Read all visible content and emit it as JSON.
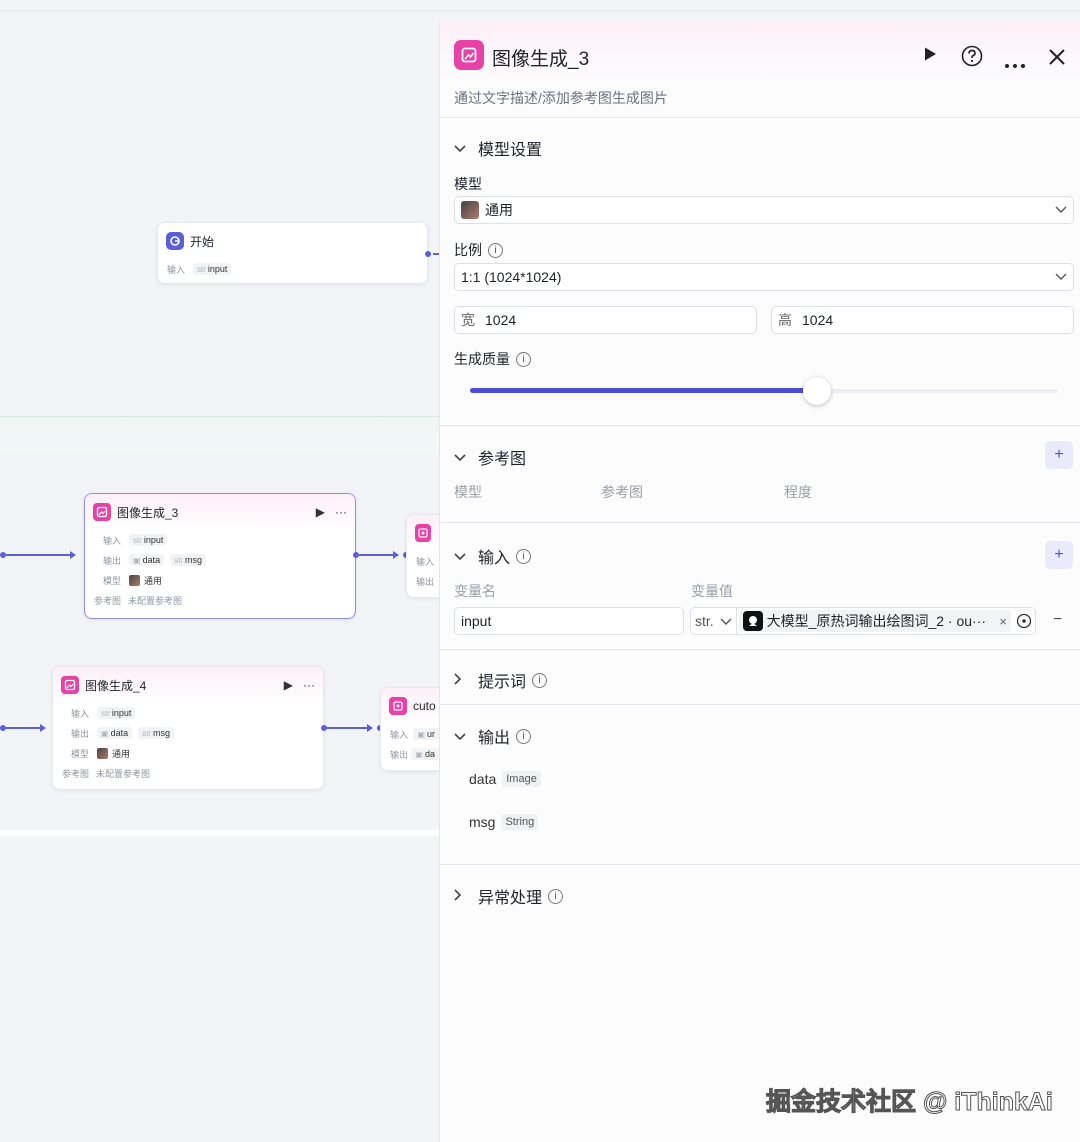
{
  "canvas": {
    "start_node": {
      "title": "开始",
      "in_label": "输入",
      "in_type": "str",
      "in_var": "input"
    },
    "node3": {
      "title": "图像生成_3",
      "run": "▶",
      "more": "···",
      "in_label": "输入",
      "out_label": "输出",
      "model_label": "模型",
      "ref_label": "参考图",
      "in_type": "str",
      "in_var": "input",
      "out1": "data",
      "out2_type": "str",
      "out2": "msg",
      "model": "通用",
      "ref_value": "未配置参考图"
    },
    "node4": {
      "title": "图像生成_4",
      "run": "▶",
      "more": "···",
      "in_label": "输入",
      "out_label": "输出",
      "model_label": "模型",
      "ref_label": "参考图",
      "in_type": "str",
      "in_var": "input",
      "out1": "data",
      "out2_type": "str",
      "out2": "msg",
      "model": "通用",
      "ref_value": "未配置参考图"
    },
    "partial_a": {
      "in_label": "输入",
      "out_label": "输出"
    },
    "partial_b": {
      "title": "cuto",
      "in_label": "输入",
      "out_label": "输出",
      "in_var": "ur",
      "out_var": "da"
    }
  },
  "panel": {
    "title": "图像生成_3",
    "description": "通过文字描述/添加参考图生成图片",
    "model_section": {
      "title": "模型设置",
      "model_label": "模型",
      "model_value": "通用",
      "ratio_label": "比例",
      "ratio_value": "1:1 (1024*1024)",
      "width_label": "宽",
      "width_value": "1024",
      "height_label": "高",
      "height_value": "1024",
      "quality_label": "生成质量",
      "quality_level": 0.59
    },
    "ref_section": {
      "title": "参考图",
      "col1": "模型",
      "col2": "参考图",
      "col3": "程度"
    },
    "input_section": {
      "title": "输入",
      "col_name": "变量名",
      "col_value": "变量值",
      "var_name": "input",
      "var_type": "str.",
      "ref_text": "大模型_原热词输出绘图词_2 · ou···",
      "clear": "×",
      "remove": "−"
    },
    "prompt_section": {
      "title": "提示词"
    },
    "output_section": {
      "title": "输出",
      "outputs": [
        {
          "name": "data",
          "type": "Image"
        },
        {
          "name": "msg",
          "type": "String"
        }
      ]
    },
    "error_section": {
      "title": "异常处理"
    }
  },
  "watermark": "掘金技术社区 @ iThinkAi",
  "colors": {
    "accent": "#4c4fd6",
    "node_icon": "#e842a8",
    "edge": "#5b5fd8"
  }
}
